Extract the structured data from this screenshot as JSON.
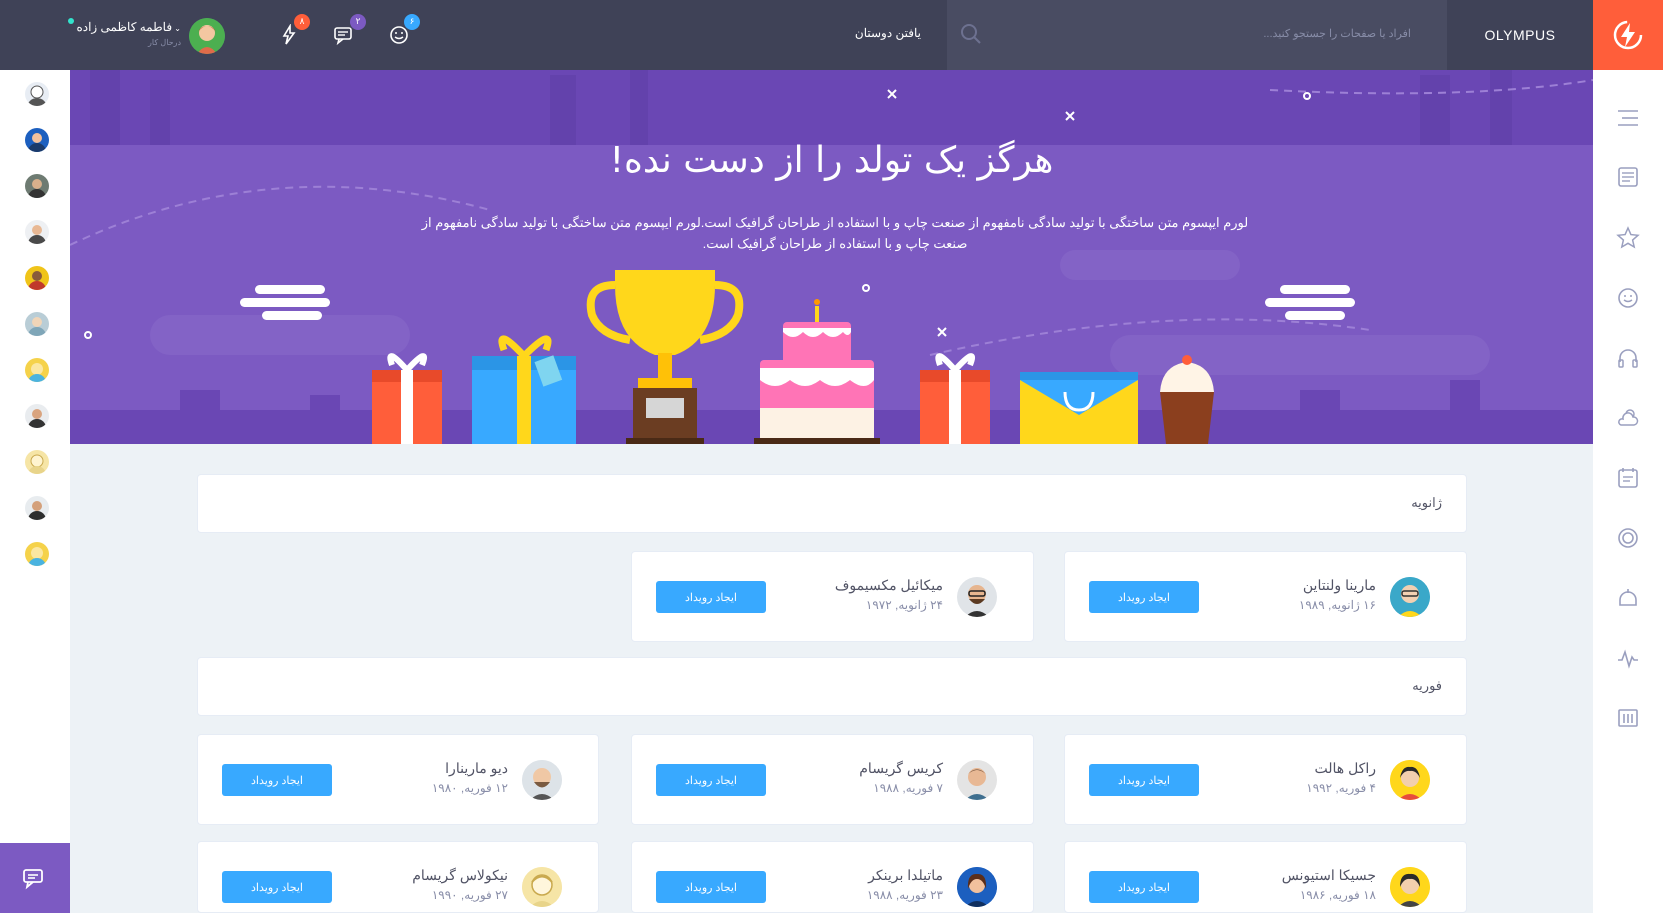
{
  "header": {
    "brand": "OLYMPUS",
    "search_placeholder": "افراد یا صفحات را جستجو کنید...",
    "find_friends": "یافتن دوستان",
    "badges": {
      "friends": "۶",
      "messages": "۲",
      "notifications": "۸"
    },
    "user": {
      "name": "فاطمه کاظمی زاده",
      "status": "درحال کار"
    }
  },
  "hero": {
    "title": "هرگز یک تولد را از دست نده!",
    "description_line1": "لورم ایپسوم متن ساختگی با تولید سادگی نامفهوم از صنعت چاپ و با استفاده از طراحان گرافیک است.لورم ایپسوم متن ساختگی با تولید سادگی نامفهوم از",
    "description_line2": "صنعت چاپ و با استفاده از طراحان گرافیک است."
  },
  "months": [
    {
      "label": "ژانویه",
      "people": [
        {
          "name": "مارینا ولنتاین",
          "date": "۱۶ ژانویه, ۱۹۸۹",
          "button": "ایجاد رویداد"
        },
        {
          "name": "میکائیل مکسیموف",
          "date": "۲۴ ژانویه, ۱۹۷۲",
          "button": "ایجاد رویداد"
        }
      ]
    },
    {
      "label": "فوریه",
      "people": [
        {
          "name": "راکل هالت",
          "date": "۴ فوریه, ۱۹۹۲",
          "button": "ایجاد رویداد"
        },
        {
          "name": "کریس گریسام",
          "date": "۷ فوریه, ۱۹۸۸",
          "button": "ایجاد رویداد"
        },
        {
          "name": "دیو مارینارا",
          "date": "۱۲ فوریه, ۱۹۸۰",
          "button": "ایجاد رویداد"
        },
        {
          "name": "جسیکا استیونس",
          "date": "۱۸ فوریه, ۱۹۸۶",
          "button": "ایجاد رویداد"
        },
        {
          "name": "ماتیلدا برینکر",
          "date": "۲۳ فوریه, ۱۹۸۸",
          "button": "ایجاد رویداد"
        },
        {
          "name": "نیکولاس گریسام",
          "date": "۲۷ فوریه, ۱۹۹۰",
          "button": "ایجاد رویداد"
        }
      ]
    }
  ],
  "colors": {
    "header": "#3f4257",
    "accent": "#ff5e3a",
    "hero": "#7c5ac2",
    "button": "#38a9ff"
  }
}
